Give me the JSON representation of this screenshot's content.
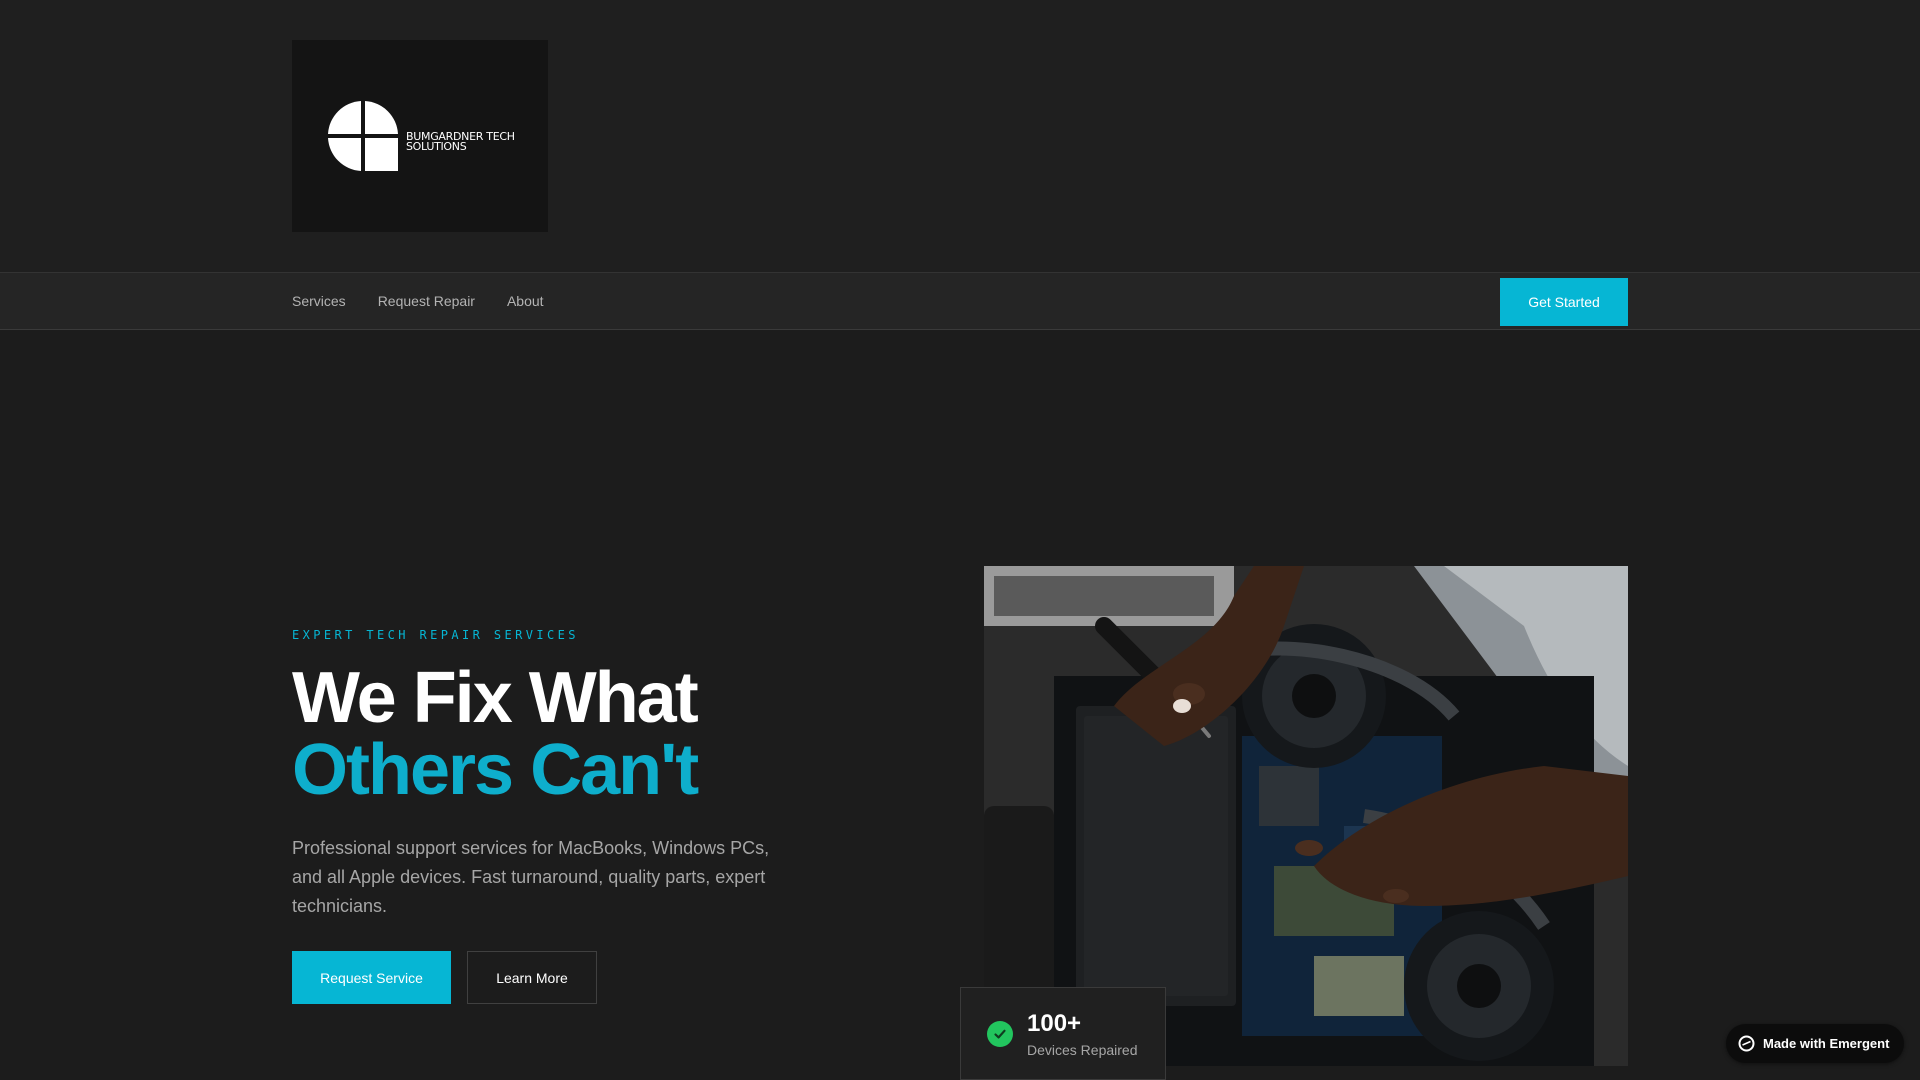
{
  "brand": {
    "name": "BUMGARDNER TECH SOLUTIONS",
    "name_line1": "BUMGARDNER TECH",
    "name_line2": "SOLUTIONS"
  },
  "nav": {
    "items": [
      {
        "label": "Services"
      },
      {
        "label": "Request Repair"
      },
      {
        "label": "About"
      }
    ],
    "cta_label": "Get Started"
  },
  "hero": {
    "eyebrow": "EXPERT TECH REPAIR SERVICES",
    "title_line1": "We Fix What",
    "title_line2": "Others Can't",
    "description": "Professional support services for MacBooks, Windows PCs, and all Apple devices. Fast turnaround, quality parts, expert technicians.",
    "primary_button": "Request Service",
    "secondary_button": "Learn More"
  },
  "stat": {
    "value": "100+",
    "label": "Devices Repaired"
  },
  "badge": {
    "label": "Made with Emergent"
  },
  "colors": {
    "accent": "#06b6d4",
    "background": "#1c1c1c",
    "success": "#22c55e"
  },
  "icons": {
    "logo": "quadrant-logo-icon",
    "stat": "check-circle-icon",
    "badge": "emergent-logo-icon"
  }
}
